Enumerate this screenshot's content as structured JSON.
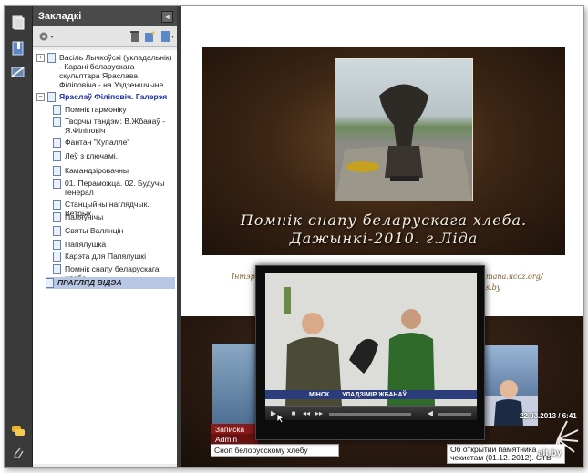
{
  "sidebar": {
    "title": "Закладкі",
    "collapse_glyph": "◂",
    "items": [
      {
        "label": "Васіль Лычкоўскі (укладальнік) - Карані беларускага скульптара Яраслава Філіповіча - на Уздзеншчыне",
        "expander": "+"
      },
      {
        "label": "Яраслаў Філіповіч. Галерэя",
        "expander": "−"
      },
      {
        "label": "Помнік гармоніку"
      },
      {
        "label": "Творчы тандэм: В.Жбанаў - Я.Філіповіч"
      },
      {
        "label": "Фантан \"Купалле\""
      },
      {
        "label": "Леў з ключамі."
      },
      {
        "label": "Камандзіровачны"
      },
      {
        "label": "01. Пераможца. 02. Будучы генерал"
      },
      {
        "label": "Станцыйны наглядчык. Ветрык"
      },
      {
        "label": "Паляўнічы"
      },
      {
        "label": "Святы Валянцін"
      },
      {
        "label": "Папялушка"
      },
      {
        "label": "Карэта для Папялушкі"
      },
      {
        "label": "Помнік снапу беларускага хлеба"
      },
      {
        "label": "ПРАГЛЯД ВІДЭА"
      }
    ]
  },
  "document": {
    "banner_line1": "Помнік снапу беларускага хлеба.",
    "banner_line2": "Дажынкі-2010. г.Ліда",
    "under_text": "Інтэр",
    "url_text": "mana.ucoz.org/",
    "url_text2": "s.by",
    "left_label": "Записка",
    "left_author": "Admin",
    "left_caption": "Сноп белорусскому хлебу",
    "right_caption": "Об открытии памятника чекистам (01.12. 2012). СТВ"
  },
  "video": {
    "lower_third_city": "МІНСК",
    "lower_third_name": "УЛАДЗІМІР ЖБАНАЎ"
  },
  "watermark": {
    "time_text": "22.03.2013 / 6:41",
    "site_text": "alt.by"
  },
  "colors": {
    "accent_blue": "#1a2ea8",
    "selection": "#b8c8e4",
    "lower_third": "#2a3c7a",
    "label_red": "#8a1a1a"
  }
}
